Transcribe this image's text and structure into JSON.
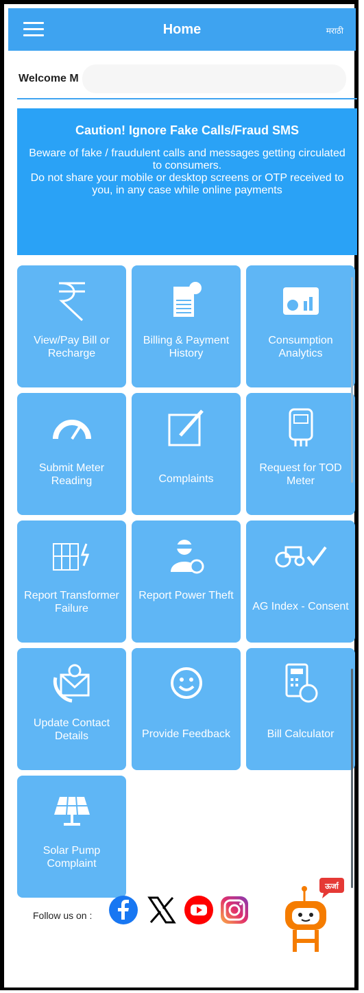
{
  "header": {
    "title": "Home",
    "language": "मराठी"
  },
  "welcome": {
    "text": "Welcome M"
  },
  "caution": {
    "title": "Caution! Ignore Fake Calls/Fraud SMS",
    "line1": "Beware of fake / fraudulent calls and messages getting circulated to consumers.",
    "line2": "Do not share your mobile or desktop screens or OTP received to you, in any case while online payments"
  },
  "tiles": [
    {
      "label": "View/Pay Bill or Recharge",
      "icon": "rupee-icon"
    },
    {
      "label": "Billing & Payment History",
      "icon": "bill-history-icon"
    },
    {
      "label": "Consumption Analytics",
      "icon": "analytics-icon"
    },
    {
      "label": "Submit Meter Reading",
      "icon": "meter-gauge-icon"
    },
    {
      "label": "Complaints",
      "icon": "edit-complaint-icon"
    },
    {
      "label": "Request for TOD Meter",
      "icon": "energy-meter-icon"
    },
    {
      "label": "Report Transformer Failure",
      "icon": "transformer-icon"
    },
    {
      "label": "Report Power Theft",
      "icon": "thief-icon"
    },
    {
      "label": "AG Index - Consent",
      "icon": "tractor-check-icon"
    },
    {
      "label": "Update Contact Details",
      "icon": "contact-phone-icon"
    },
    {
      "label": "Provide Feedback",
      "icon": "smiley-icon"
    },
    {
      "label": "Bill Calculator",
      "icon": "calculator-icon"
    },
    {
      "label": "Solar Pump Complaint",
      "icon": "solar-panel-icon"
    }
  ],
  "footer": {
    "follow_text": "Follow us on :",
    "social": [
      "facebook-icon",
      "x-icon",
      "youtube-icon",
      "instagram-icon"
    ],
    "chatbot_badge": "ऊर्जा"
  },
  "colors": {
    "primary": "#3ea3f0",
    "tile": "#5fb6f5",
    "caution": "#2aa2f6"
  }
}
